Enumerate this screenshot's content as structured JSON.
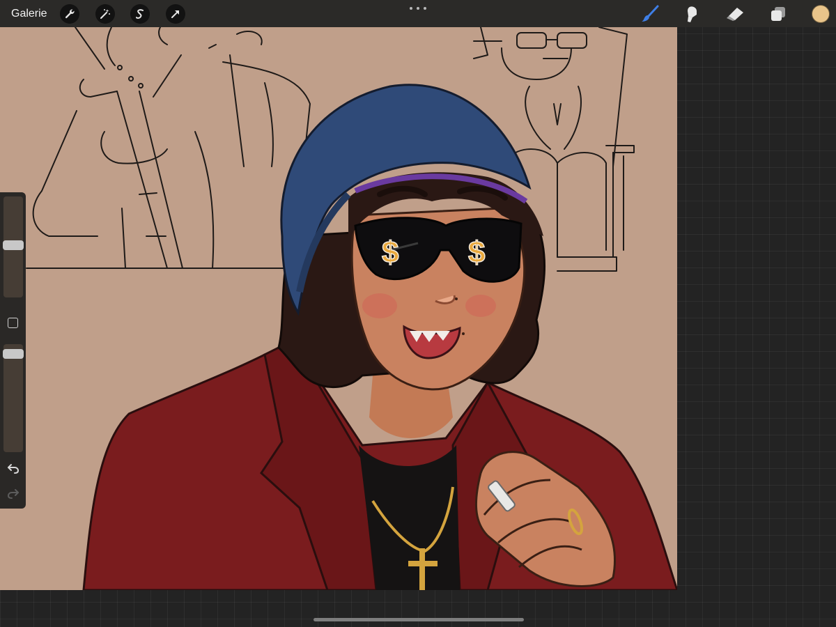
{
  "topbar": {
    "gallery_label": "Galerie",
    "left_tools": [
      {
        "name": "actions",
        "icon": "wrench-icon"
      },
      {
        "name": "adjustments",
        "icon": "magic-wand-icon"
      },
      {
        "name": "selection",
        "icon": "selection-s-icon"
      },
      {
        "name": "transform",
        "icon": "arrow-cursor-icon"
      }
    ],
    "more_icon": "ellipsis-icon",
    "right_tools": [
      {
        "name": "brush",
        "icon": "brush-icon",
        "active": true
      },
      {
        "name": "smudge",
        "icon": "smudge-finger-icon",
        "active": false
      },
      {
        "name": "eraser",
        "icon": "eraser-icon",
        "active": false
      },
      {
        "name": "layers",
        "icon": "layers-icon",
        "active": false
      }
    ],
    "current_color": "#e9c48a",
    "active_tool_color": "#3f7fe6"
  },
  "sidebar": {
    "brush_size_level": 0.52,
    "opacity_level": 0.95,
    "modify_icon": "square-icon",
    "undo_icon": "undo-arrow-icon",
    "redo_icon": "redo-arrow-icon"
  },
  "canvas": {
    "background_color": "#c09f8a",
    "artwork": "illustration-character-beanie-sunglasses"
  }
}
